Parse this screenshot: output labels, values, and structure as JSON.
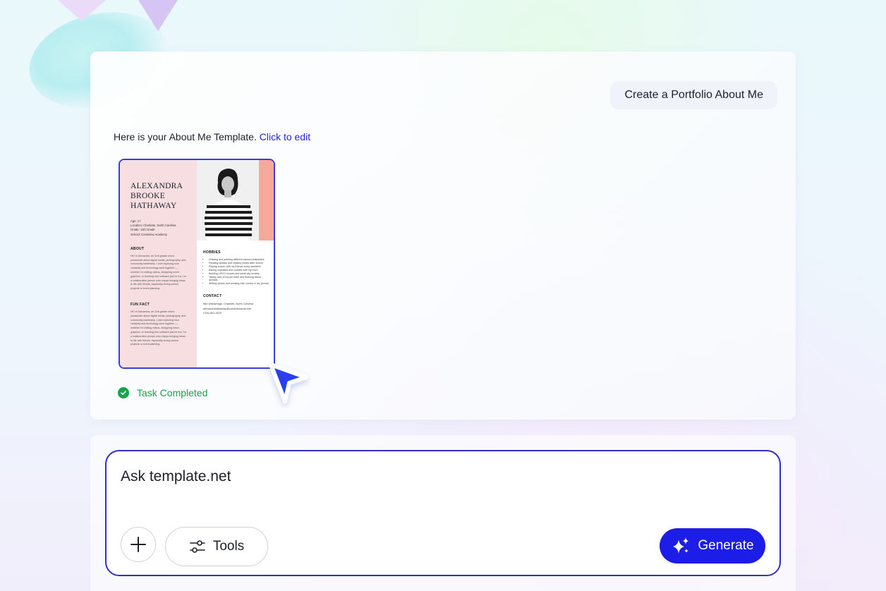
{
  "chat": {
    "user_message": "Create a Portfolio About Me",
    "assistant_intro": "Here is your About Me Template.",
    "edit_link": "Click to edit",
    "status": "Task Completed"
  },
  "template": {
    "name_line1": "ALEXANDRA",
    "name_line2": "BROOKE",
    "name_line3": "HATHAWAY",
    "info": [
      "Age: 17",
      "Location: Charlotte, North Carolina",
      "Grade: 11th Grade",
      "School: Crestview Academy"
    ],
    "about_heading": "ABOUT",
    "about_text": "Hi! I'm Alexandra, an 11th grader who's passionate about digital media, photography, and community leadership. I love exploring how creativity and technology work together — whether I'm editing videos, designing event graphics, or learning new software just for fun. I'm a collaborative person who enjoys bringing ideas to life with friends, especially during school projects or event planning.",
    "funfact_heading": "FUN FACT",
    "funfact_text": "Hi! I'm Alexandra, an 11th grader who's passionate about digital media, photography, and community leadership. I love exploring how creativity and technology work together — whether I'm editing videos, designing event graphics, or learning new software just for fun. I'm a collaborative person who enjoys bringing ideas to life with friends, especially during school projects or event planning.",
    "hobbies_heading": "HOBBIES",
    "hobbies": [
      "Drawing and painting different cartoon characters",
      "Reading fantasy and mystery books after school",
      "Playing soccer with my friends every weekend",
      "Baking cupcakes and cookies with my mom",
      "Building LEGO houses and small city models",
      "Taking care of my pet turtle and learning about animals",
      "Writing stories and creating mini comics in my journal"
    ],
    "contact_heading": "CONTACT",
    "contact": [
      "584 Willowridge, Charlotte, North Carolina",
      "alexandrahathaway@crestviewacad.edu",
      "(704) 661-4520"
    ],
    "colors": {
      "left_bg": "#f7dfe1",
      "accent": "#f6a99a",
      "border": "#3b3fd8"
    }
  },
  "composer": {
    "placeholder": "Ask template.net",
    "plus_icon": "plus-icon",
    "tools_label": "Tools",
    "tools_icon": "sliders-icon",
    "generate_label": "Generate",
    "generate_icon": "sparkles-icon",
    "accent": "#1d1de8"
  }
}
